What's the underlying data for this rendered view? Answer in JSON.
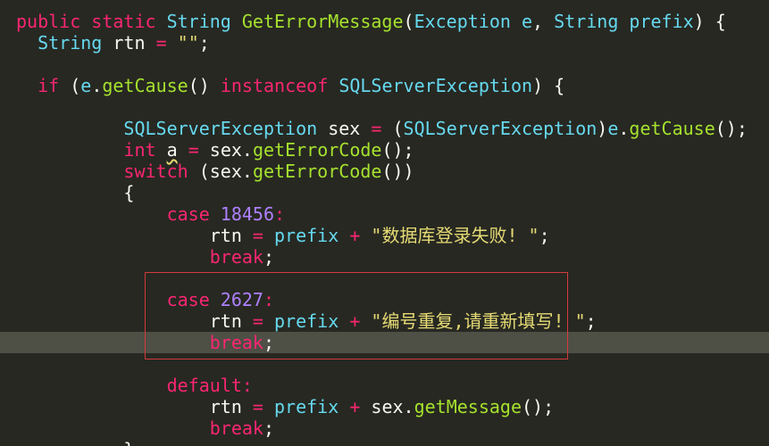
{
  "colors": {
    "background": "#272822",
    "keyword": "#f92672",
    "type": "#66d9ef",
    "function": "#a6e22e",
    "number": "#ae81ff",
    "string": "#e6db74",
    "text": "#f8f8f2",
    "current_line": "#4e4f45",
    "annotation_box": "#d33b3b"
  },
  "code": {
    "public": "public",
    "static": "static",
    "String": "String",
    "method_name": "GetErrorMessage",
    "Exception": "Exception",
    "e": "e",
    "prefix": "prefix",
    "rtn": "rtn",
    "empty_string": "\"\"",
    "if": "if",
    "getCause": "getCause",
    "instanceof": "instanceof",
    "SQLServerException": "SQLServerException",
    "sex": "sex",
    "int": "int",
    "a": "a",
    "getErrorCode": "getErrorCode",
    "switch": "switch",
    "case": "case",
    "case1_value": "18456",
    "case1_message": "\"数据库登录失败! \"",
    "break": "break",
    "case2_value": "2627",
    "case2_message": "\"编号重复,请重新填写! \"",
    "default": "default",
    "getMessage": "getMessage"
  }
}
